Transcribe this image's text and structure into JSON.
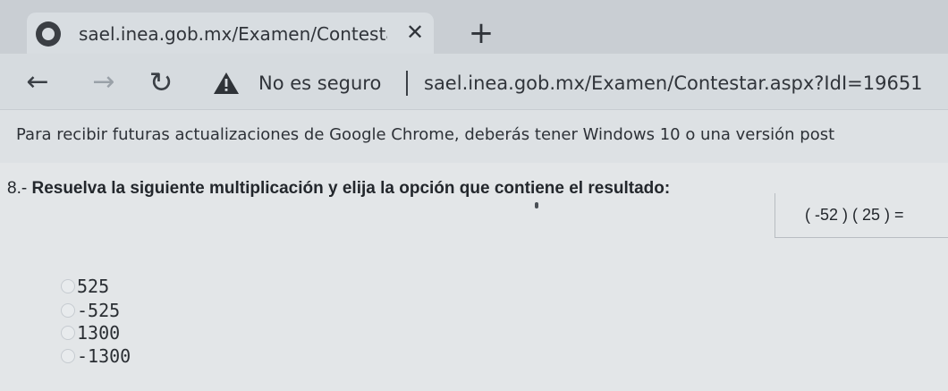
{
  "browser": {
    "tab_title": "sael.inea.gob.mx/Examen/Contesta",
    "tab_close": "✕",
    "new_tab": "+",
    "back": "←",
    "forward": "→",
    "reload": "↻",
    "security_label": "No es seguro",
    "url": "sael.inea.gob.mx/Examen/Contestar.aspx?IdI=19651",
    "infobar_text": "Para recibir futuras actualizaciones de Google Chrome, deberás tener Windows 10 o una versión post"
  },
  "exam": {
    "question_number": "8.-",
    "question_text": "Resuelva la siguiente multiplicación y elija la opción que contiene el resultado:",
    "expression": "( -52 ) ( 25 ) =",
    "options": [
      {
        "label": "525"
      },
      {
        "label": "-525"
      },
      {
        "label": "1300"
      },
      {
        "label": "-1300"
      }
    ]
  },
  "icons": {
    "favicon": "globe-icon",
    "warning": "warning-triangle-icon"
  }
}
